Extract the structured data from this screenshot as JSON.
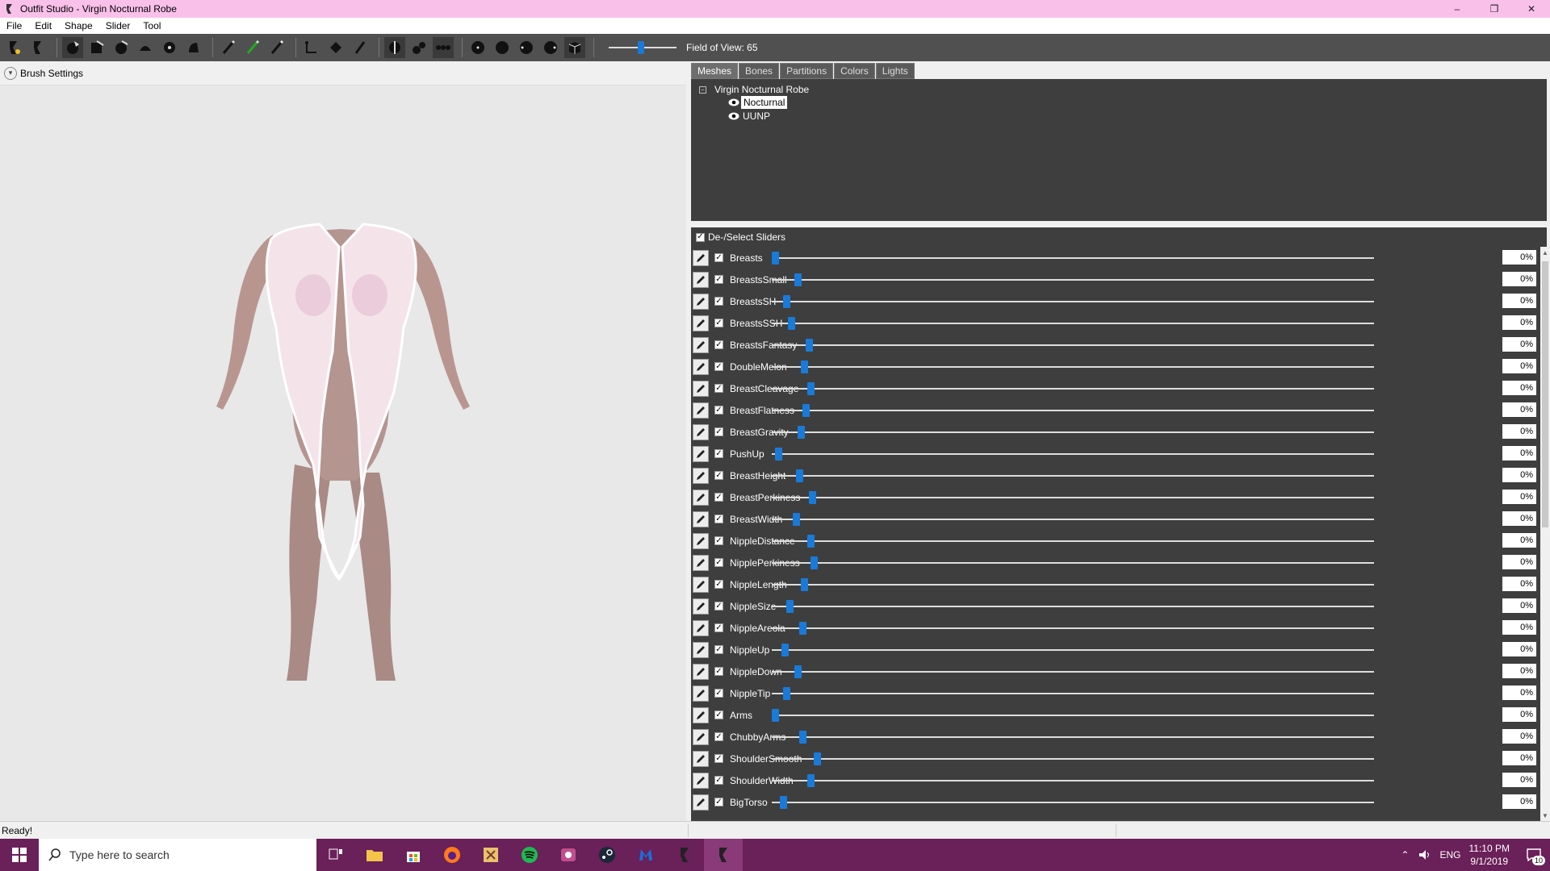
{
  "window": {
    "title": "Outfit Studio - Virgin Nocturnal Robe",
    "minimize": "–",
    "restore": "❐",
    "close": "✕"
  },
  "menu": [
    "File",
    "Edit",
    "Shape",
    "Slider",
    "Tool"
  ],
  "toolbar": {
    "fov_label": "Field of View: 65"
  },
  "brush_settings": {
    "label": "Brush Settings"
  },
  "tabs": [
    "Meshes",
    "Bones",
    "Partitions",
    "Colors",
    "Lights"
  ],
  "mesh_tree": {
    "root": "Virgin Nocturnal Robe",
    "children": [
      "Nocturnal",
      "UUNP"
    ]
  },
  "sliders_header": {
    "label": "De-/Select Sliders"
  },
  "sliders": [
    {
      "name": "Breasts",
      "value": "0%"
    },
    {
      "name": "BreastsSmall",
      "value": "0%"
    },
    {
      "name": "BreastsSH",
      "value": "0%"
    },
    {
      "name": "BreastsSSH",
      "value": "0%"
    },
    {
      "name": "BreastsFantasy",
      "value": "0%"
    },
    {
      "name": "DoubleMelon",
      "value": "0%"
    },
    {
      "name": "BreastCleavage",
      "value": "0%"
    },
    {
      "name": "BreastFlatness",
      "value": "0%"
    },
    {
      "name": "BreastGravity",
      "value": "0%"
    },
    {
      "name": "PushUp",
      "value": "0%"
    },
    {
      "name": "BreastHeight",
      "value": "0%"
    },
    {
      "name": "BreastPerkiness",
      "value": "0%"
    },
    {
      "name": "BreastWidth",
      "value": "0%"
    },
    {
      "name": "NippleDistance",
      "value": "0%"
    },
    {
      "name": "NipplePerkiness",
      "value": "0%"
    },
    {
      "name": "NippleLength",
      "value": "0%"
    },
    {
      "name": "NippleSize",
      "value": "0%"
    },
    {
      "name": "NippleAreola",
      "value": "0%"
    },
    {
      "name": "NippleUp",
      "value": "0%"
    },
    {
      "name": "NippleDown",
      "value": "0%"
    },
    {
      "name": "NippleTip",
      "value": "0%"
    },
    {
      "name": "Arms",
      "value": "0%"
    },
    {
      "name": "ChubbyArms",
      "value": "0%"
    },
    {
      "name": "ShoulderSmooth",
      "value": "0%"
    },
    {
      "name": "ShoulderWidth",
      "value": "0%"
    },
    {
      "name": "BigTorso",
      "value": "0%"
    }
  ],
  "status": {
    "text": "Ready!"
  },
  "taskbar": {
    "search_placeholder": "Type here to search",
    "language": "ENG",
    "time": "11:10 PM",
    "date": "9/1/2019",
    "notifications": "10"
  },
  "colors": {
    "titlebar": "#f9c0ea",
    "toolbar": "#505050",
    "panel_dark": "#3e3e3e",
    "slider_thumb": "#1a7ad8",
    "taskbar": "#6a2058"
  }
}
